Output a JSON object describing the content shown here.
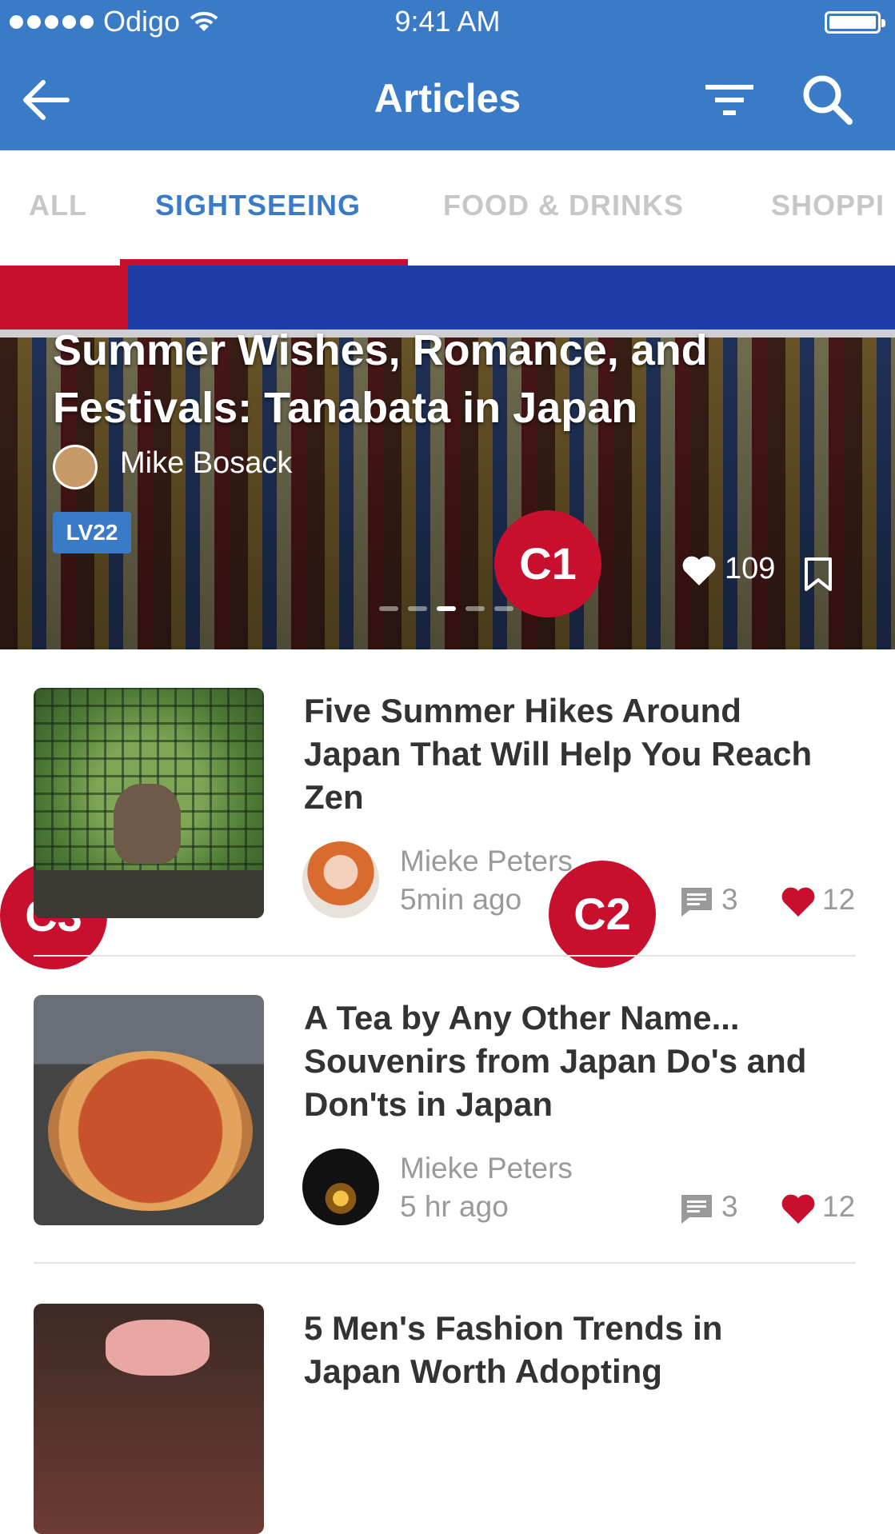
{
  "status_bar": {
    "carrier": "Odigo",
    "time": "9:41 AM"
  },
  "nav": {
    "title": "Articles"
  },
  "tabs": [
    {
      "label": "ALL"
    },
    {
      "label": "SIGHTSEEING"
    },
    {
      "label": "FOOD & DRINKS"
    },
    {
      "label": "SHOPPI"
    }
  ],
  "hero": {
    "title": "Summer Wishes, Romance, and Festivals: Tanabata in Japan",
    "author": "Mike Bosack",
    "level": "LV22",
    "likes": "109",
    "pager": {
      "pages": 5,
      "active": 2
    }
  },
  "markers": {
    "c1": "C1",
    "c2": "C2",
    "c3": "C3"
  },
  "articles": [
    {
      "title": "Five Summer Hikes Around Japan That Will Help You Reach Zen",
      "author": "Mieke Peters",
      "time": "5min ago",
      "comments": "3",
      "likes": "12"
    },
    {
      "title": "A Tea by Any Other Name... Souvenirs from Japan Do's and Don'ts in Japan",
      "author": "Mieke Peters",
      "time": "5 hr ago",
      "comments": "3",
      "likes": "12"
    },
    {
      "title": "5 Men's Fashion Trends in Japan Worth Adopting"
    }
  ],
  "colors": {
    "primary": "#3a7bc8",
    "accent": "#c8102e",
    "muted_text": "#9a9a9a"
  },
  "icons": [
    "back-arrow-icon",
    "filter-icon",
    "search-icon",
    "wifi-icon",
    "battery-icon",
    "heart-icon",
    "bookmark-icon",
    "comment-icon"
  ]
}
